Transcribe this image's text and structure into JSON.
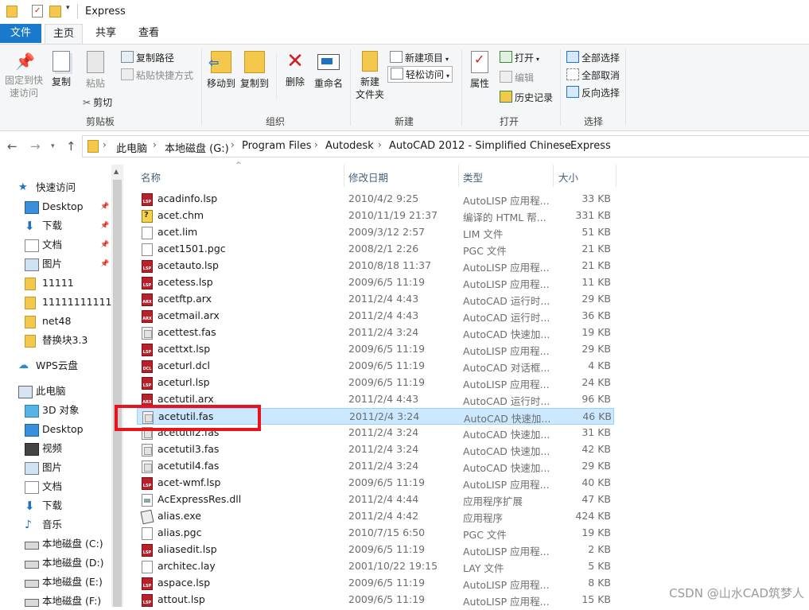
{
  "window": {
    "title": "Express"
  },
  "ribbon_tabs": [
    "文件",
    "主页",
    "共享",
    "查看"
  ],
  "ribbon": {
    "clipboard": {
      "pin": "固定到快\n速访问",
      "copy": "复制",
      "paste": "粘贴",
      "copy_path": "复制路径",
      "paste_shortcut": "粘贴快捷方式",
      "cut": "剪切",
      "label": "剪贴板"
    },
    "organize": {
      "move_to": "移动到",
      "copy_to": "复制到",
      "delete": "删除",
      "rename": "重命名",
      "label": "组织"
    },
    "new": {
      "new_folder": "新建\n文件夹",
      "new_item": "新建项目",
      "easy_access": "轻松访问",
      "label": "新建"
    },
    "open": {
      "properties": "属性",
      "open": "打开",
      "edit": "编辑",
      "history": "历史记录",
      "label": "打开"
    },
    "select": {
      "select_all": "全部选择",
      "select_none": "全部取消",
      "invert": "反向选择",
      "label": "选择"
    }
  },
  "breadcrumb": [
    "此电脑",
    "本地磁盘 (G:)",
    "Program Files",
    "Autodesk",
    "AutoCAD 2012 - Simplified Chinese",
    "Express"
  ],
  "nav_pane": [
    {
      "label": "快速访问",
      "icon": "star-icon",
      "indent": 0
    },
    {
      "label": "Desktop",
      "icon": "desktop-icon",
      "indent": 1,
      "pinned": true
    },
    {
      "label": "下载",
      "icon": "download-icon",
      "indent": 1,
      "pinned": true
    },
    {
      "label": "文档",
      "icon": "document-icon",
      "indent": 1,
      "pinned": true
    },
    {
      "label": "图片",
      "icon": "picture-icon",
      "indent": 1,
      "pinned": true
    },
    {
      "label": "11111",
      "icon": "folder-icon",
      "indent": 1
    },
    {
      "label": "111111111111",
      "icon": "folder-icon",
      "indent": 1
    },
    {
      "label": "net48",
      "icon": "folder-icon",
      "indent": 1
    },
    {
      "label": "替换块3.3",
      "icon": "folder-icon",
      "indent": 1
    },
    {
      "label": "WPS云盘",
      "icon": "cloud-icon",
      "indent": 0
    },
    {
      "label": "此电脑",
      "icon": "computer-icon",
      "indent": 0
    },
    {
      "label": "3D 对象",
      "icon": "3d-objects-icon",
      "indent": 1
    },
    {
      "label": "Desktop",
      "icon": "desktop-icon",
      "indent": 1
    },
    {
      "label": "视频",
      "icon": "video-icon",
      "indent": 1
    },
    {
      "label": "图片",
      "icon": "picture-icon",
      "indent": 1
    },
    {
      "label": "文档",
      "icon": "document-icon",
      "indent": 1
    },
    {
      "label": "下载",
      "icon": "download-icon",
      "indent": 1
    },
    {
      "label": "音乐",
      "icon": "music-icon",
      "indent": 1
    },
    {
      "label": "本地磁盘 (C:)",
      "icon": "drive-icon",
      "indent": 1
    },
    {
      "label": "本地磁盘 (D:)",
      "icon": "drive-icon",
      "indent": 1
    },
    {
      "label": "本地磁盘 (E:)",
      "icon": "drive-icon",
      "indent": 1
    },
    {
      "label": "本地磁盘 (F:)",
      "icon": "drive-icon",
      "indent": 1
    }
  ],
  "columns": {
    "name": "名称",
    "modified": "修改日期",
    "type": "类型",
    "size": "大小"
  },
  "files": [
    {
      "name": "acadinfo.lsp",
      "modified": "2010/4/2 9:25",
      "type": "AutoLISP 应用程...",
      "size": "33 KB",
      "icon": "lsp"
    },
    {
      "name": "acet.chm",
      "modified": "2010/11/19 21:37",
      "type": "编译的 HTML 帮...",
      "size": "331 KB",
      "icon": "chm"
    },
    {
      "name": "acet.lim",
      "modified": "2009/3/12 2:57",
      "type": "LIM 文件",
      "size": "51 KB",
      "icon": "blank"
    },
    {
      "name": "acet1501.pgc",
      "modified": "2008/2/1 2:26",
      "type": "PGC 文件",
      "size": "21 KB",
      "icon": "blank"
    },
    {
      "name": "acetauto.lsp",
      "modified": "2010/8/18 11:37",
      "type": "AutoLISP 应用程...",
      "size": "21 KB",
      "icon": "lsp"
    },
    {
      "name": "acetess.lsp",
      "modified": "2009/6/5 11:19",
      "type": "AutoLISP 应用程...",
      "size": "11 KB",
      "icon": "lsp"
    },
    {
      "name": "acetftp.arx",
      "modified": "2011/2/4 4:43",
      "type": "AutoCAD 运行时...",
      "size": "29 KB",
      "icon": "arx"
    },
    {
      "name": "acetmail.arx",
      "modified": "2011/2/4 4:43",
      "type": "AutoCAD 运行时...",
      "size": "36 KB",
      "icon": "arx"
    },
    {
      "name": "acettest.fas",
      "modified": "2011/2/4 3:24",
      "type": "AutoCAD 快速加...",
      "size": "19 KB",
      "icon": "fas"
    },
    {
      "name": "acettxt.lsp",
      "modified": "2009/6/5 11:19",
      "type": "AutoLISP 应用程...",
      "size": "29 KB",
      "icon": "lsp"
    },
    {
      "name": "aceturl.dcl",
      "modified": "2009/6/5 11:19",
      "type": "AutoCAD 对话框...",
      "size": "4 KB",
      "icon": "dcl"
    },
    {
      "name": "aceturl.lsp",
      "modified": "2009/6/5 11:19",
      "type": "AutoLISP 应用程...",
      "size": "24 KB",
      "icon": "lsp"
    },
    {
      "name": "acetutil.arx",
      "modified": "2011/2/4 4:43",
      "type": "AutoCAD 运行时...",
      "size": "96 KB",
      "icon": "arx"
    },
    {
      "name": "acetutil.fas",
      "modified": "2011/2/4 3:24",
      "type": "AutoCAD 快速加...",
      "size": "46 KB",
      "icon": "fas",
      "selected": true
    },
    {
      "name": "acetutil2.fas",
      "modified": "2011/2/4 3:24",
      "type": "AutoCAD 快速加...",
      "size": "31 KB",
      "icon": "fas"
    },
    {
      "name": "acetutil3.fas",
      "modified": "2011/2/4 3:24",
      "type": "AutoCAD 快速加...",
      "size": "42 KB",
      "icon": "fas"
    },
    {
      "name": "acetutil4.fas",
      "modified": "2011/2/4 3:24",
      "type": "AutoCAD 快速加...",
      "size": "29 KB",
      "icon": "fas"
    },
    {
      "name": "acet-wmf.lsp",
      "modified": "2009/6/5 11:19",
      "type": "AutoLISP 应用程...",
      "size": "40 KB",
      "icon": "lsp"
    },
    {
      "name": "AcExpressRes.dll",
      "modified": "2011/2/4 4:44",
      "type": "应用程序扩展",
      "size": "47 KB",
      "icon": "dll"
    },
    {
      "name": "alias.exe",
      "modified": "2011/2/4 4:42",
      "type": "应用程序",
      "size": "424 KB",
      "icon": "exe"
    },
    {
      "name": "alias.pgc",
      "modified": "2010/7/15 6:50",
      "type": "PGC 文件",
      "size": "19 KB",
      "icon": "blank"
    },
    {
      "name": "aliasedit.lsp",
      "modified": "2009/6/5 11:19",
      "type": "AutoLISP 应用程...",
      "size": "2 KB",
      "icon": "lsp"
    },
    {
      "name": "architec.lay",
      "modified": "2001/10/22 19:15",
      "type": "LAY 文件",
      "size": "5 KB",
      "icon": "blank"
    },
    {
      "name": "aspace.lsp",
      "modified": "2009/6/5 11:19",
      "type": "AutoLISP 应用程...",
      "size": "8 KB",
      "icon": "lsp"
    },
    {
      "name": "attout.lsp",
      "modified": "2009/6/5 11:19",
      "type": "AutoLISP 应用程...",
      "size": "15 KB",
      "icon": "lsp"
    }
  ],
  "watermark": "CSDN @山水CAD筑梦人",
  "colors": {
    "accent": "#1979ca",
    "selection": "#cce8ff",
    "highlight_box": "#e8141c"
  }
}
